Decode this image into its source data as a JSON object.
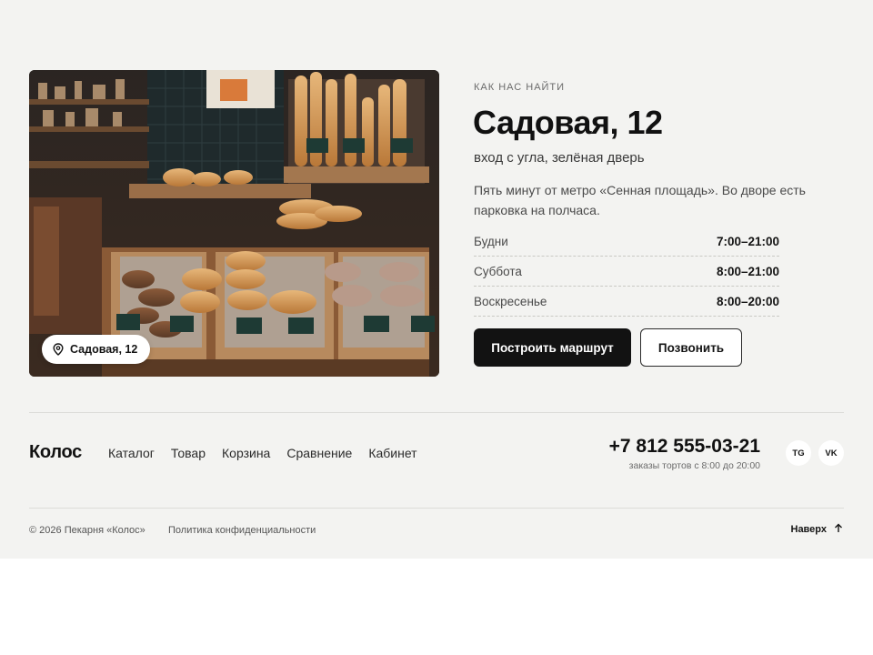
{
  "location": {
    "eyebrow": "КАК НАС НАЙТИ",
    "address": "Садовая, 12",
    "entrance": "вход с угла, зелёная дверь",
    "description": "Пять минут от метро «Сенная площадь». Во дворе есть парковка на полчаса.",
    "photo_badge": "Садовая, 12",
    "hours": [
      {
        "day": "Будни",
        "time": "7:00–21:00"
      },
      {
        "day": "Суббота",
        "time": "8:00–21:00"
      },
      {
        "day": "Воскресенье",
        "time": "8:00–20:00"
      }
    ],
    "route_button": "Построить маршрут",
    "call_button": "Позвонить"
  },
  "footer": {
    "logo": "Колос",
    "nav": [
      "Каталог",
      "Товар",
      "Корзина",
      "Сравнение",
      "Кабинет"
    ],
    "phone": "+7 812 555-03-21",
    "phone_note": "заказы тортов с 8:00 до 20:00",
    "social": [
      "TG",
      "VK"
    ],
    "copyright": "© 2026 Пекарня «Колос»",
    "privacy": "Политика конфиденциальности",
    "to_top": "Наверх"
  },
  "colors": {
    "background": "#f3f3f1",
    "primary_button": "#121212",
    "text": "#141414"
  },
  "icons": {
    "badge": "map-pin-icon",
    "to_top": "arrow-up-icon"
  }
}
